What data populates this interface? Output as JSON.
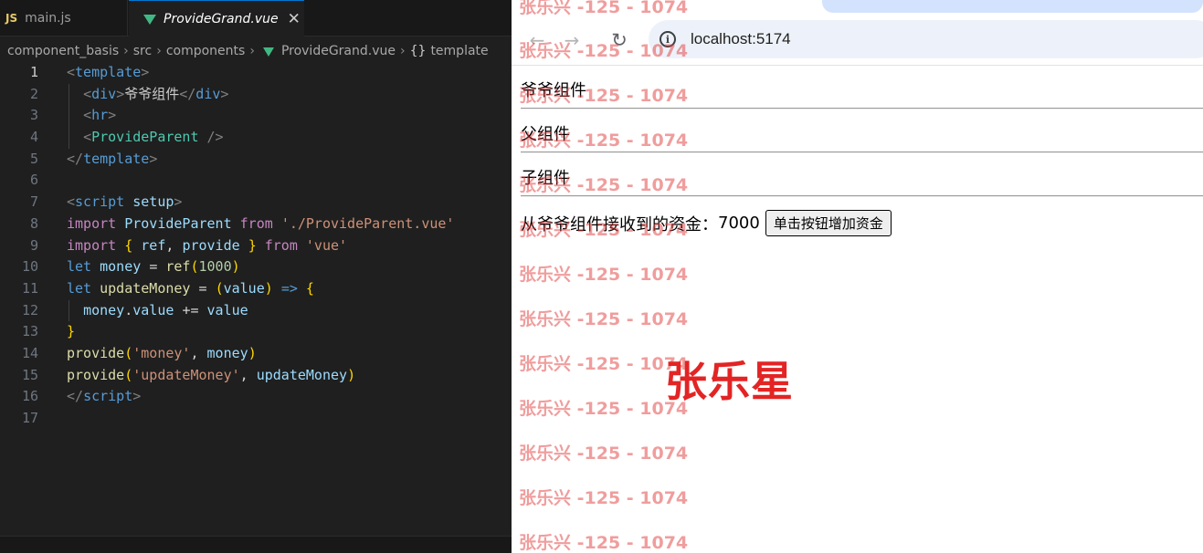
{
  "editor": {
    "tabs": [
      {
        "badge": "JS",
        "label": "main.js"
      },
      {
        "label": "ProvideGrand.vue",
        "close": "✕"
      }
    ],
    "breadcrumb": [
      "component_basis",
      "src",
      "components",
      "ProvideGrand.vue",
      "template"
    ],
    "breadcrumb_sep": "›",
    "line_numbers": [
      "1",
      "2",
      "3",
      "4",
      "5",
      "6",
      "7",
      "8",
      "9",
      "10",
      "11",
      "12",
      "13",
      "14",
      "15",
      "16",
      "17"
    ]
  },
  "browser": {
    "url": "localhost:5174",
    "content": {
      "grand_label": "爷爷组件",
      "parent_label": "父组件",
      "child_label": "子组件",
      "money_prefix": "从爷爷组件接收到的资金：",
      "money_value": "7000",
      "button_label": "单击按钮增加资金"
    },
    "watermark_text": "张乐兴 -125 - 1074",
    "big_mark": "张乐星"
  },
  "colors": {
    "vue_green": "#41b883",
    "accent_blue": "#0078d4",
    "watermark": "#e13c3c",
    "big_mark": "#e32424"
  },
  "icons": [
    "js-icon",
    "vue-icon",
    "close-icon",
    "back-arrow-icon",
    "forward-arrow-icon",
    "reload-icon",
    "info-icon",
    "braces-icon"
  ]
}
